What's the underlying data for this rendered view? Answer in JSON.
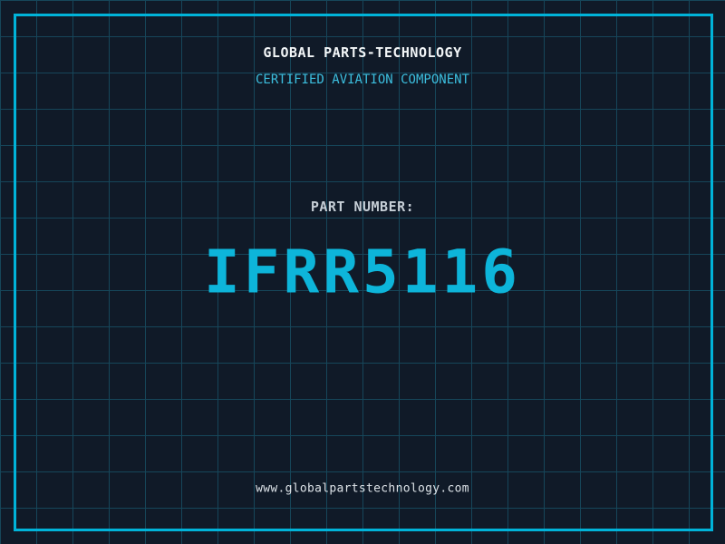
{
  "header": {
    "company": "GLOBAL PARTS-TECHNOLOGY",
    "subtitle": "CERTIFIED AVIATION COMPONENT"
  },
  "part": {
    "label": "PART NUMBER:",
    "number": "IFRR5116"
  },
  "footer": {
    "website": "www.globalpartstechnology.com"
  },
  "colors": {
    "background": "#101a28",
    "grid_line": "#16465a",
    "frame": "#00b3d9",
    "title": "#f2f5f7",
    "subtitle": "#3cbfdf",
    "part_label": "#c6ced6",
    "part_number": "#0db5da",
    "website": "#dde3e8"
  }
}
